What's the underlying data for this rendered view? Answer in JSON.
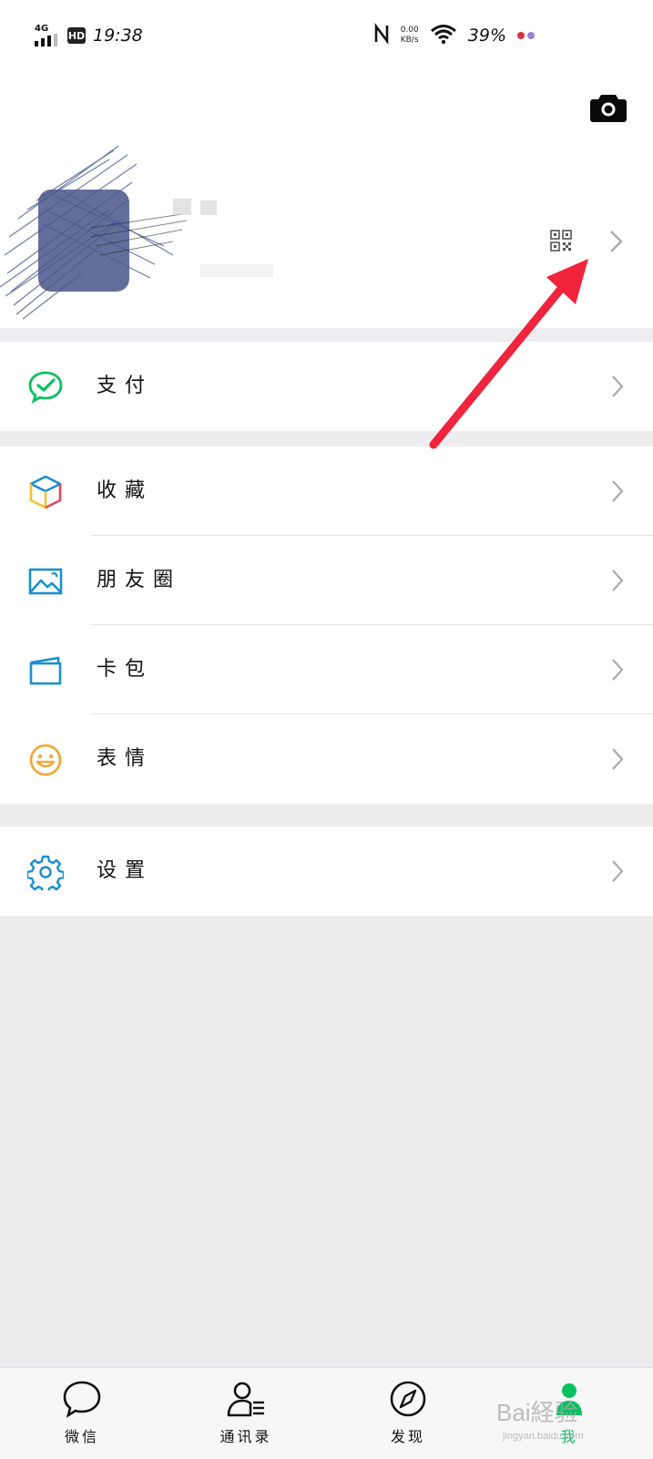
{
  "status_bar": {
    "signal": "4G",
    "hd": "HD",
    "time": "19:38",
    "net_speed_value": "0.00",
    "net_speed_unit": "KB/s",
    "battery": "39%"
  },
  "profile": {
    "camera_icon": "camera-icon",
    "qr_icon": "qr-code-icon"
  },
  "menu": {
    "pay": {
      "label": "支付",
      "icon": "wechat-pay-icon"
    },
    "favorites": {
      "label": "收藏",
      "icon": "favorites-cube-icon"
    },
    "moments": {
      "label": "朋友圈",
      "icon": "moments-image-icon"
    },
    "cards": {
      "label": "卡包",
      "icon": "card-wallet-icon"
    },
    "stickers": {
      "label": "表情",
      "icon": "smiley-icon"
    },
    "settings": {
      "label": "设置",
      "icon": "gear-icon"
    }
  },
  "tab_bar": {
    "tabs": [
      {
        "label": "微信",
        "icon": "chat-bubble-icon"
      },
      {
        "label": "通讯录",
        "icon": "contacts-icon"
      },
      {
        "label": "发现",
        "icon": "compass-icon"
      },
      {
        "label": "我",
        "icon": "me-person-icon"
      }
    ]
  },
  "watermark": {
    "text": "Bai経验",
    "sub": "jingyan.baidu.com"
  },
  "colors": {
    "accent_green": "#07c160",
    "arrow_red": "#f0243c",
    "icon_blue": "#1a8fd1",
    "icon_orange": "#f0a93a"
  }
}
